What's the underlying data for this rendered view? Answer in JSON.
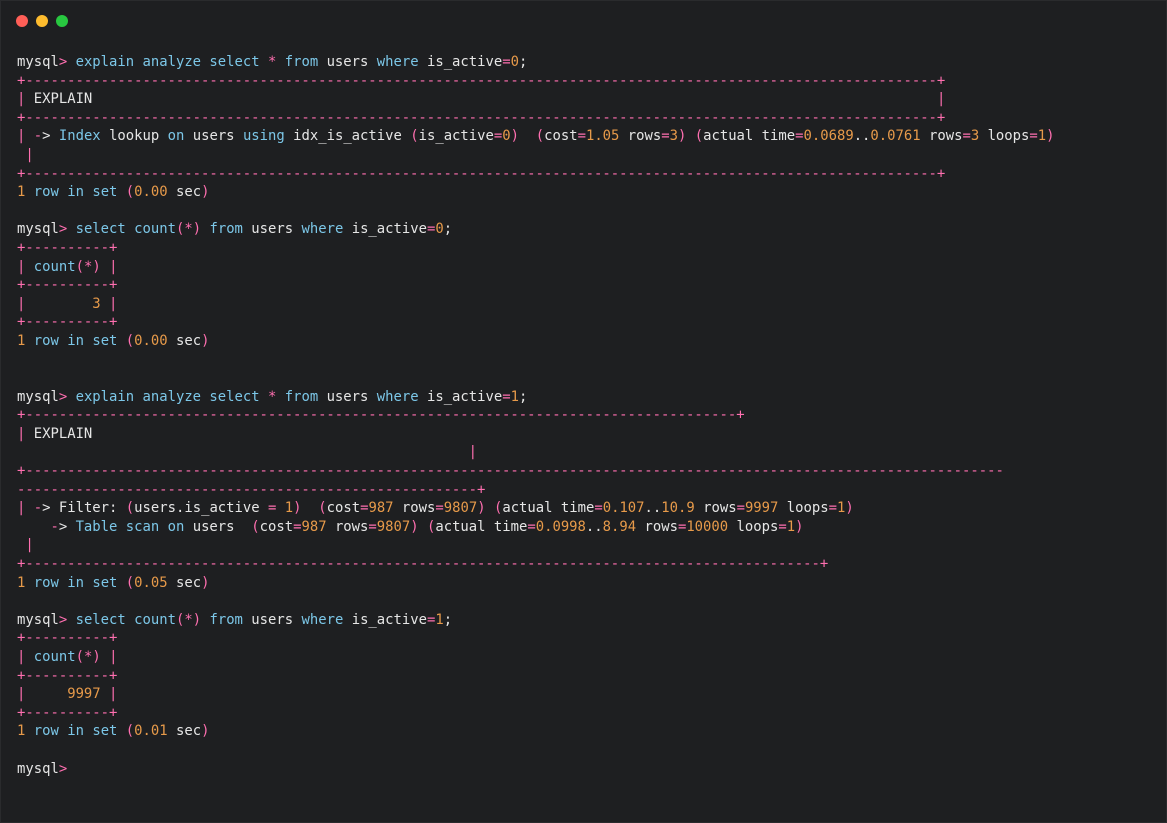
{
  "window": {
    "controls": [
      {
        "name": "close",
        "color": "#ff5f57"
      },
      {
        "name": "minimize",
        "color": "#febc2e"
      },
      {
        "name": "maximize",
        "color": "#28c840"
      }
    ]
  },
  "colors": {
    "background": "#1e1f21",
    "text": "#e6e6e6",
    "border": "#ff6fb0",
    "keyword": "#7cc7e8",
    "number": "#e79a4a"
  },
  "terminal": {
    "prompt": "mysql>",
    "blocks": [
      {
        "command": "explain analyze select * from users where is_active=0;",
        "table": {
          "border": "+-------------------------------------------------------------------------------------------------------------+",
          "header": "| EXPLAIN                                                                                                     |",
          "rows": [
            "| -> Index lookup on users using idx_is_active (is_active=0)  (cost=1.05 rows=3) (actual time=0.0689..0.0761 rows=3 loops=1)",
            " |"
          ]
        },
        "result": "1 row in set (0.00 sec)"
      },
      {
        "command": "select count(*) from users where is_active=0;",
        "table": {
          "border": "+----------+",
          "header": "| count(*) |",
          "rows": [
            "|        3 |"
          ]
        },
        "result": "1 row in set (0.00 sec)"
      },
      {
        "command": "explain analyze select * from users where is_active=1;",
        "table": {
          "border_top": "+-------------------------------------------------------------------------------------+",
          "header": "| EXPLAIN",
          "header_tail": "                                                      |",
          "border_mid_a": "+---------------------------------------------------------------------------------------------------------------------",
          "border_mid_b": "-------------------------------------------------------+",
          "rows": [
            "| -> Filter: (users.is_active = 1)  (cost=987 rows=9807) (actual time=0.107..10.9 rows=9997 loops=1)",
            "    -> Table scan on users  (cost=987 rows=9807) (actual time=0.0998..8.94 rows=10000 loops=1)",
            " |"
          ],
          "border_bottom": "+-----------------------------------------------------------------------------------------------+"
        },
        "result": "1 row in set (0.05 sec)"
      },
      {
        "command": "select count(*) from users where is_active=1;",
        "table": {
          "border": "+----------+",
          "header": "| count(*) |",
          "rows": [
            "|     9997 |"
          ]
        },
        "result": "1 row in set (0.01 sec)"
      }
    ]
  }
}
